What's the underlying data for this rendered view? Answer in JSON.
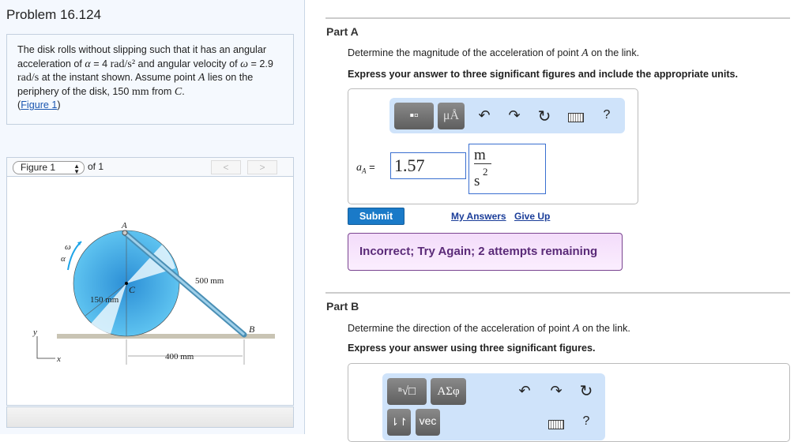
{
  "problem": {
    "title": "Problem 16.124",
    "text_1": "The disk rolls without slipping such that it has an angular acceleration of ",
    "alpha_sym": "α",
    "eq": " = 4 ",
    "alpha_unit": "rad/s²",
    "text_2": " and angular velocity of ",
    "omega_sym": "ω",
    "eq2": " = 2.9 ",
    "omega_unit": "rad/s",
    "text_3": " at the instant shown. Assume point ",
    "pointA": "A",
    "text_4": " lies on the periphery of the disk, 150 ",
    "mm": "mm",
    "text_5": " from ",
    "pointC": "C",
    "text_6": ".",
    "link_open": "(",
    "figure_link": "Figure 1",
    "link_close": ")"
  },
  "figure_nav": {
    "selected": "Figure 1",
    "of_label": "of 1",
    "prev": "<",
    "next": ">"
  },
  "figure": {
    "label_A": "A",
    "label_B": "B",
    "label_C": "C",
    "omega": "ω",
    "alpha": "α",
    "dim_500": "500 mm",
    "dim_150": "150 mm",
    "dim_400": "400 mm",
    "axis_x": "x",
    "axis_y": "y",
    "disk_color": "#3aa3e0"
  },
  "partA": {
    "heading": "Part A",
    "question_pre": "Determine the magnitude of the acceleration of point ",
    "question_var": "A",
    "question_post": " on the link.",
    "instruction": "Express your answer to three significant figures and include the appropriate units.",
    "toolbar": {
      "templates": "▪▫",
      "units": "μÅ",
      "undo": "↶",
      "redo": "↷",
      "reset": "↻",
      "help": "?"
    },
    "var_label": "a",
    "var_sub": "A",
    "eq": " =",
    "value": "1.57",
    "unit_num": "m",
    "unit_den": "s",
    "unit_exp": "2",
    "submit": "Submit",
    "my_answers": "My Answers",
    "give_up": "Give Up",
    "feedback": "Incorrect; Try Again; 2 attempts remaining"
  },
  "partB": {
    "heading": "Part B",
    "question_pre": "Determine the direction of the acceleration of point ",
    "question_var": "A",
    "question_post": " on the link.",
    "instruction": "Express your answer using three significant figures.",
    "toolbar": {
      "templates": "ⁿ√□",
      "greek": "ΑΣφ",
      "arrows": "⇂↾",
      "vec": "vec",
      "help": "?"
    }
  }
}
